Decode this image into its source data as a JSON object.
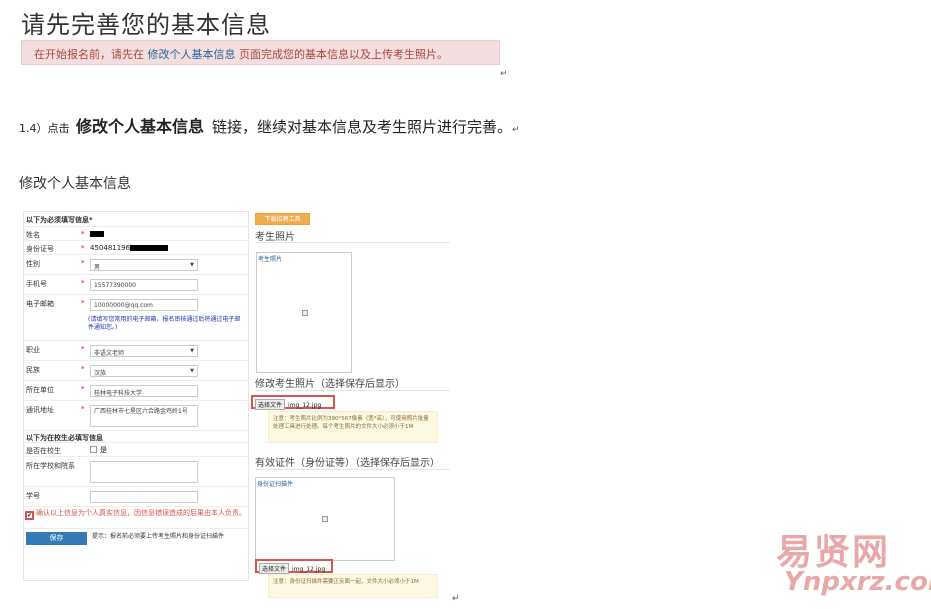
{
  "page_title": "请先完善您的基本信息",
  "alert": {
    "before": "在开始报名前，请先在 ",
    "link": "修改个人基本信息",
    "after": " 页面完成您的基本信息以及上传考生照片。"
  },
  "para_marks": [
    "↵",
    "↵"
  ],
  "step": {
    "num": "1.4）点击 ",
    "bold": "修改个人基本信息",
    "rest": "链接，继续对基本信息及考生照片进行完善。",
    "mark": "↵"
  },
  "section_title": "修改个人基本信息",
  "form": {
    "required_head": "以下为必须填写信息",
    "required_mark": "*",
    "name_label": "姓名",
    "id_label": "身份证号",
    "id_value": "450481196",
    "gender_label": "性别",
    "gender_value": "男",
    "phone_label": "手机号",
    "phone_value": "15577390000",
    "email_label": "电子邮箱",
    "email_value": "10000000@qq.com",
    "email_hint": "(请填写您常用的电子邮箱，报名审核通过后将通过电子邮件通知您。)",
    "job_label": "职业",
    "job_value": "非语文老师",
    "nation_label": "民族",
    "nation_value": "汉族",
    "org_label": "所在单位",
    "org_value": "桂林电子科技大学",
    "addr_label": "通讯地址",
    "addr_value": "广西桂林市七星区六合路金鸡岭1号",
    "student_head": "以下为在校生必填写信息",
    "is_student_label": "是否在校生",
    "is_student_value": "是",
    "school_label": "所在学校和院系",
    "student_no_label": "学号",
    "confirm_text": "确认以上信息为个人真实信息，因信息错误造成的后果由本人负责。",
    "save_label": "保存",
    "tip": "提示：报名前必须要上传考生照片和身份证扫描件",
    "star": "*"
  },
  "right": {
    "download_btn": "下载招聘工具",
    "photo_head": "考生照片",
    "photo_caption": "考生照片",
    "modify_photo_head": "修改考生照片（选择保存后显示）",
    "choose_file": "选择文件",
    "file_name": "img_12.jpg",
    "photo_note": "注意：考生照片比例为390*567像素（宽*高），可使用照片批量处理工具进行处理。每个考生照片的文件大小必须小于1M",
    "id_head": "有效证件（身份证等）（选择保存后显示）",
    "id_caption": "身份证扫描件",
    "id_file_name": "img_12.jpg",
    "id_note": "注意：身份证扫描件需要正反面一起，文件大小必须小于1M"
  },
  "watermark": {
    "cn": "易贤网",
    "en": "Ynpxrz.com"
  },
  "colors": {
    "alert_bg": "#f2dede",
    "alert_text": "#a94442",
    "link": "#2a6496",
    "save_btn": "#337ab7",
    "download_btn": "#f0ad4e",
    "highlight_border": "#d9534f",
    "note_bg": "#fcf8e3",
    "watermark": "#e9a8a8"
  }
}
